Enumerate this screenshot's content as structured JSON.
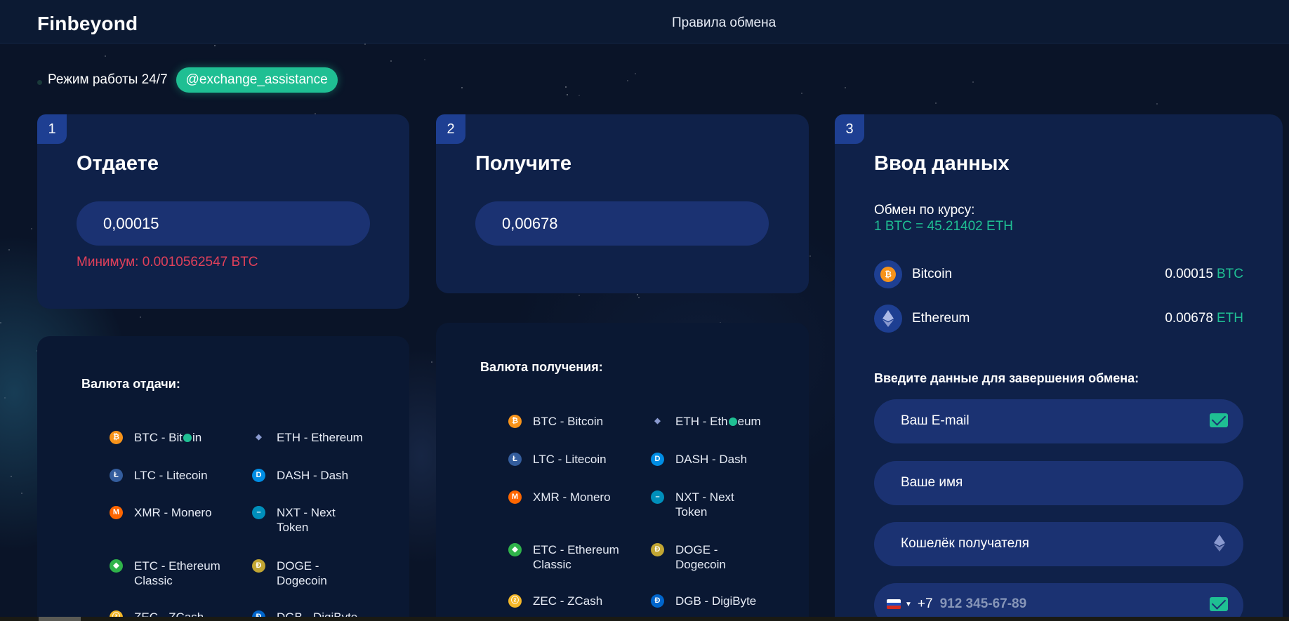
{
  "header": {
    "logo": "Finbeyond",
    "nav_rules": "Правила обмена"
  },
  "status": {
    "schedule": "Режим работы 24/7",
    "telegram": "@exchange_assistance"
  },
  "give": {
    "step": "1",
    "title": "Отдаете",
    "amount": "0,00015",
    "minimum": "Минимум: 0.0010562547 BTC"
  },
  "receive": {
    "step": "2",
    "title": "Получите",
    "amount": "0,00678"
  },
  "give_list": {
    "heading": "Валюта отдачи:",
    "items": [
      {
        "a": "BTC - Bit",
        "b": "in",
        "icon": "bitcoin-icon",
        "color": "#f7931a",
        "glyph": "₿",
        "active": true
      },
      {
        "a": "ETH - Ethereum",
        "icon": "ethereum-icon",
        "color": "#627eea",
        "glyph": "◆"
      },
      {
        "a": "LTC - Litecoin",
        "icon": "litecoin-icon",
        "color": "#345d9d",
        "glyph": "Ł"
      },
      {
        "a": "DASH - Dash",
        "icon": "dash-icon",
        "color": "#008de4",
        "glyph": "D"
      },
      {
        "a": "XMR - Monero",
        "icon": "monero-icon",
        "color": "#ff6600",
        "glyph": "M"
      },
      {
        "a": "NXT - Next",
        "b2": "Token",
        "icon": "nxt-icon",
        "color": "#008fbb",
        "glyph": "–"
      },
      {
        "a": "ETC - Ethereum",
        "b2": "Classic",
        "icon": "ethereum-classic-icon",
        "color": "#2fb34a",
        "glyph": "◆"
      },
      {
        "a": "DOGE -",
        "b2": "Dogecoin",
        "icon": "dogecoin-icon",
        "color": "#c2a633",
        "glyph": "Ð"
      },
      {
        "a": "ZEC - ZCash",
        "icon": "zcash-icon",
        "color": "#f4b728",
        "glyph": "ⓩ"
      },
      {
        "a": "DGB - DigiByte",
        "icon": "digibyte-icon",
        "color": "#0066cc",
        "glyph": "Ð"
      }
    ]
  },
  "receive_list": {
    "heading": "Валюта получения:",
    "items": [
      {
        "a": "BTC - Bitcoin",
        "icon": "bitcoin-icon",
        "color": "#f7931a",
        "glyph": "₿"
      },
      {
        "a": "ETH - Eth",
        "b": "eum",
        "icon": "ethereum-icon",
        "color": "#627eea",
        "glyph": "◆",
        "active": true
      },
      {
        "a": "LTC - Litecoin",
        "icon": "litecoin-icon",
        "color": "#345d9d",
        "glyph": "Ł"
      },
      {
        "a": "DASH - Dash",
        "icon": "dash-icon",
        "color": "#008de4",
        "glyph": "D"
      },
      {
        "a": "XMR - Monero",
        "icon": "monero-icon",
        "color": "#ff6600",
        "glyph": "M"
      },
      {
        "a": "NXT - Next",
        "b2": "Token",
        "icon": "nxt-icon",
        "color": "#008fbb",
        "glyph": "–"
      },
      {
        "a": "ETC - Ethereum",
        "b2": "Classic",
        "icon": "ethereum-classic-icon",
        "color": "#2fb34a",
        "glyph": "◆"
      },
      {
        "a": "DOGE -",
        "b2": "Dogecoin",
        "icon": "dogecoin-icon",
        "color": "#c2a633",
        "glyph": "Ð"
      },
      {
        "a": "ZEC - ZCash",
        "icon": "zcash-icon",
        "color": "#f4b728",
        "glyph": "ⓩ"
      },
      {
        "a": "DGB - DigiByte",
        "icon": "digibyte-icon",
        "color": "#0066cc",
        "glyph": "Ð"
      }
    ]
  },
  "data_panel": {
    "step": "3",
    "title": "Ввод данных",
    "rate_label": "Обмен по курсу:",
    "rate_value": "1 BTC = 45.21402 ETH",
    "give_coin": {
      "name": "Bitcoin",
      "amount": "0.00015",
      "currency": "BTC"
    },
    "get_coin": {
      "name": "Ethereum",
      "amount": "0.00678",
      "currency": "ETH"
    },
    "form_heading": "Введите данные для завершения обмена:",
    "email_placeholder": "Ваш E-mail",
    "name_placeholder": "Ваше имя",
    "wallet_placeholder": "Кошелёк получателя",
    "phone_code": "+7",
    "phone_placeholder": "912 345-67-89"
  },
  "colors": {
    "accent": "#1fbf93",
    "error": "#e0405a",
    "card": "#0f2149",
    "field": "#1b3272",
    "step": "#1e3f92"
  }
}
